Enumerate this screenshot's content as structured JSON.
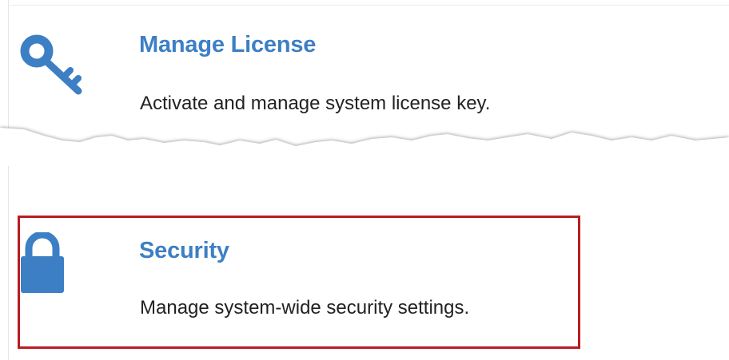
{
  "items": [
    {
      "title": "Manage License",
      "description": "Activate and manage system license key.",
      "icon": "key-icon"
    },
    {
      "title": "Security",
      "description": "Manage system-wide security settings.",
      "icon": "lock-icon"
    }
  ],
  "colors": {
    "accent": "#3d7fc4",
    "highlight": "#b81c22",
    "text": "#222222"
  }
}
